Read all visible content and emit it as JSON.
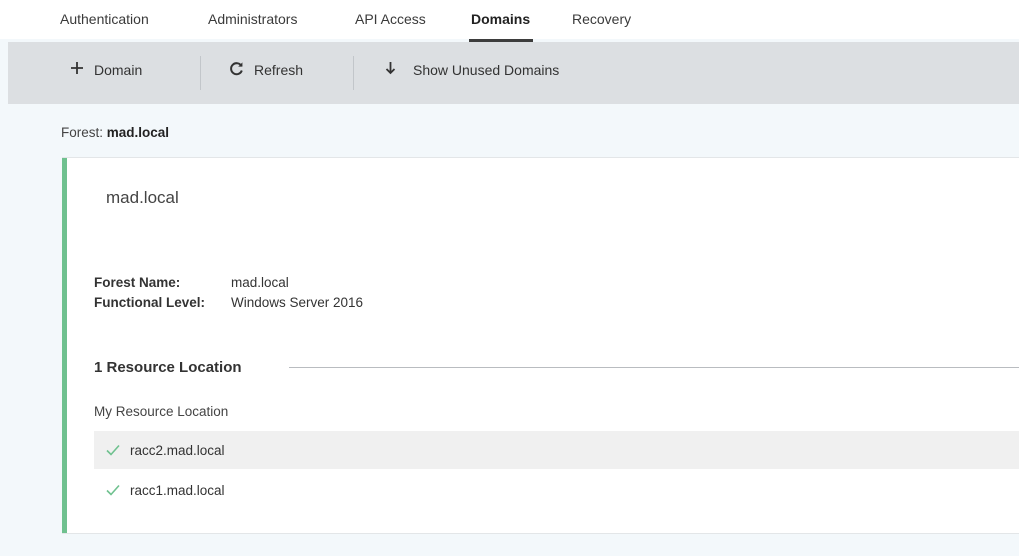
{
  "tabs": [
    {
      "label": "Authentication",
      "active": false
    },
    {
      "label": "Administrators",
      "active": false
    },
    {
      "label": "API Access",
      "active": false
    },
    {
      "label": "Domains",
      "active": true
    },
    {
      "label": "Recovery",
      "active": false
    }
  ],
  "toolbar": {
    "add_domain": {
      "icon": "plus-icon",
      "label": "Domain"
    },
    "refresh": {
      "icon": "refresh-icon",
      "label": "Refresh"
    },
    "show_unused": {
      "icon": "arrow-down-icon",
      "label": "Show Unused Domains"
    }
  },
  "forest": {
    "prefix": "Forest:",
    "name": "mad.local"
  },
  "card": {
    "title": "mad.local",
    "details": [
      {
        "key": "Forest Name:",
        "value": "mad.local"
      },
      {
        "key": "Functional Level:",
        "value": "Windows Server 2016"
      }
    ],
    "resource_location_header": "1 Resource Location",
    "resource_location_name": "My Resource Location",
    "connectors": [
      {
        "name": "racc2.mad.local",
        "status": "ok"
      },
      {
        "name": "racc1.mad.local",
        "status": "ok"
      }
    ]
  },
  "colors": {
    "accent_bar": "#6fc18f",
    "check": "#6fc18f",
    "toolbar_bg": "#dcdfe2",
    "page_bg": "#f3f8fb"
  }
}
